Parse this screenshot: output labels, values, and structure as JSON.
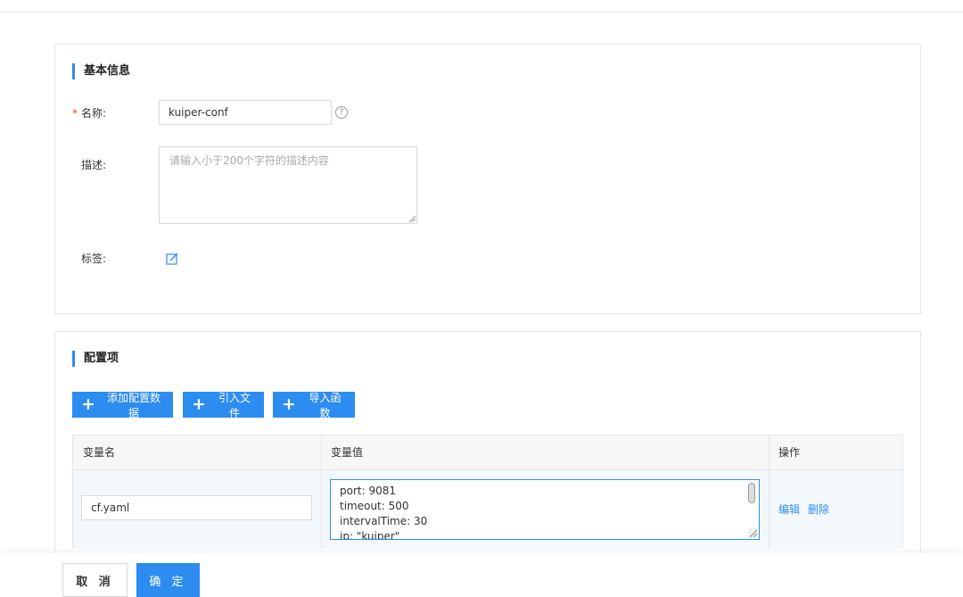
{
  "basic": {
    "title": "基本信息",
    "name_label": "名称:",
    "name_value": "kuiper-conf",
    "help_icon": "question-circle-icon",
    "desc_label": "描述:",
    "desc_placeholder": "请输入小于200个字符的描述内容",
    "tags_label": "标签:",
    "edit_icon": "edit-icon"
  },
  "config": {
    "title": "配置项",
    "buttons": {
      "add": "添加配置数据",
      "import_file": "引入文件",
      "import_func": "导入函数"
    },
    "table": {
      "headers": [
        "变量名",
        "变量值",
        "操作"
      ],
      "rows": [
        {
          "name": "cf.yaml",
          "value_lines": [
            "port: 9081",
            "timeout: 500",
            "intervalTime: 30",
            "ip: \"kuiper\""
          ],
          "edit": "编辑",
          "delete": "删除"
        }
      ]
    }
  },
  "footer": {
    "cancel": "取 消",
    "confirm": "确 定"
  },
  "colors": {
    "accent": "#2d8cf0",
    "required": "#ed4014"
  }
}
